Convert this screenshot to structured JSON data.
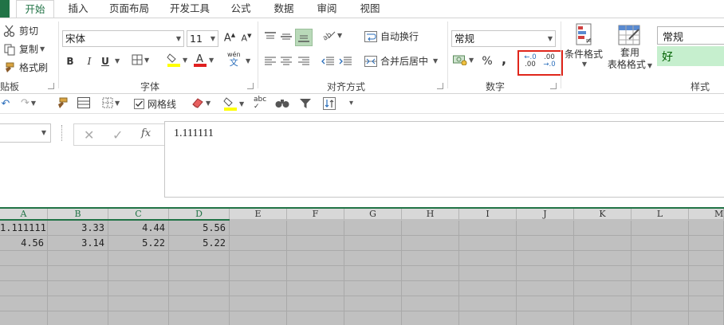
{
  "tabs": [
    {
      "label": "开始",
      "active": true
    },
    {
      "label": "插入"
    },
    {
      "label": "页面布局"
    },
    {
      "label": "开发工具"
    },
    {
      "label": "公式"
    },
    {
      "label": "数据"
    },
    {
      "label": "审阅"
    },
    {
      "label": "视图"
    }
  ],
  "clipboard": {
    "cut": "剪切",
    "copy": "复制",
    "format_painter": "格式刷",
    "group": "贴板"
  },
  "font": {
    "name": "宋体",
    "size": "11",
    "group": "字体",
    "bold": "B",
    "italic": "I",
    "underline": "U",
    "phonetic_top": "wén",
    "phonetic_bottom": "文"
  },
  "alignment": {
    "wrap": "自动换行",
    "merge": "合并后居中",
    "group": "对齐方式"
  },
  "number": {
    "format": "常规",
    "percent": "%",
    "comma": ",",
    "group": "数字",
    "inc_top": "←.0",
    "inc_bottom": ".00",
    "dec_top": ".00",
    "dec_bottom": "→.0"
  },
  "styles": {
    "conditional": "条件格式",
    "table_top": "套用",
    "table_bottom": "表格格式",
    "style_normal": "常规",
    "style_good": "好",
    "group": "样式"
  },
  "qat": {
    "gridlines": "网格线",
    "gridlines_checked": true
  },
  "formula": {
    "value": "1.111111",
    "fx": "fx"
  },
  "columns": [
    "A",
    "B",
    "C",
    "D",
    "E",
    "F",
    "G",
    "H",
    "I",
    "J",
    "K",
    "L",
    "M"
  ],
  "rows": [
    [
      "1.111111",
      "3.33",
      "4.44",
      "5.56"
    ],
    [
      "4.56",
      "3.14",
      "5.22",
      "5.22"
    ]
  ],
  "colors": {
    "accent": "#217346",
    "highlight_box": "#e0261b",
    "good_fill": "#c6efce",
    "good_text": "#006100",
    "grid_bg": "#c0c0c0"
  }
}
